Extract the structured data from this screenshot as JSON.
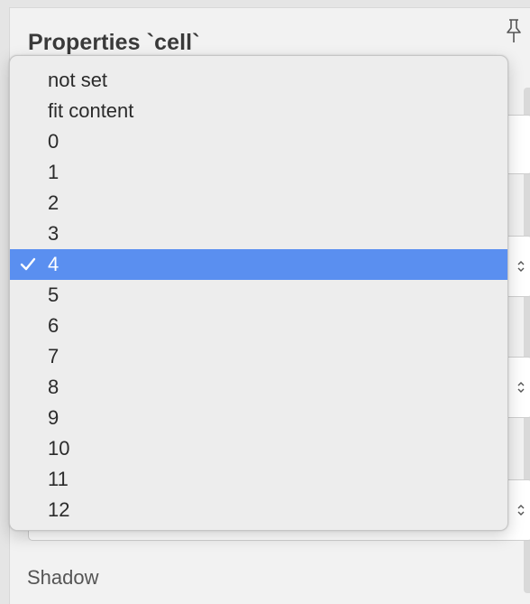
{
  "panel": {
    "title": "Properties `cell`",
    "shadow_label": "Shadow"
  },
  "icons": {
    "pin": "pin-icon",
    "check": "checkmark-icon",
    "stepper": "up-down-stepper-icon"
  },
  "colors": {
    "selected_bg": "#5a8ff0",
    "menu_bg": "#ededed",
    "panel_bg": "#f2f2f2"
  },
  "menu": {
    "selected_value": "4",
    "items": [
      {
        "label": "not set"
      },
      {
        "label": "fit content"
      },
      {
        "label": "0"
      },
      {
        "label": "1"
      },
      {
        "label": "2"
      },
      {
        "label": "3"
      },
      {
        "label": "4",
        "selected": true
      },
      {
        "label": "5"
      },
      {
        "label": "6"
      },
      {
        "label": "7"
      },
      {
        "label": "8"
      },
      {
        "label": "9"
      },
      {
        "label": "10"
      },
      {
        "label": "11"
      },
      {
        "label": "12"
      }
    ]
  }
}
